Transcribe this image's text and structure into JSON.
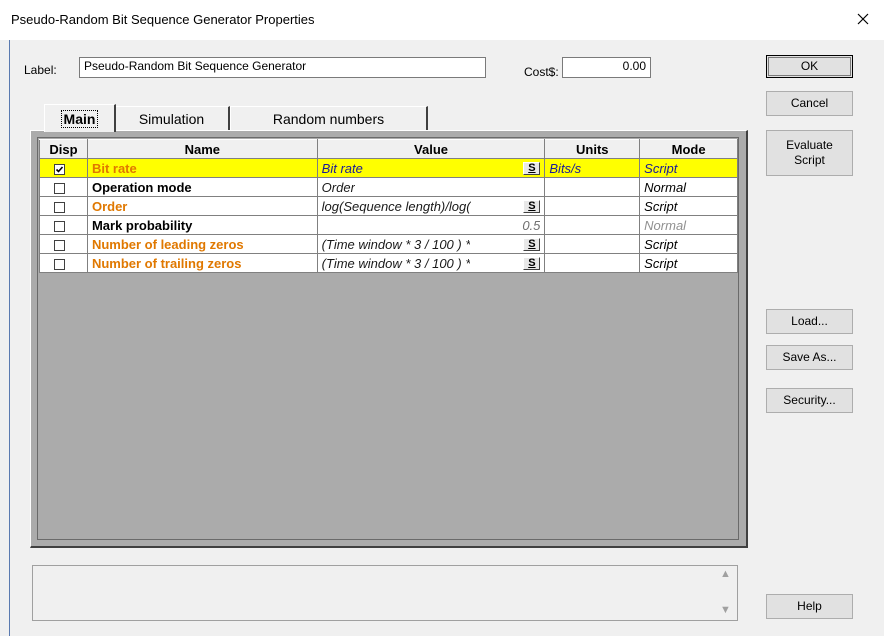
{
  "window": {
    "title": "Pseudo-Random Bit Sequence Generator Properties",
    "close_glyph": "✕"
  },
  "form": {
    "label_caption": "Label:",
    "label_value": "Pseudo-Random Bit Sequence Generator",
    "cost_caption": "Cost$:",
    "cost_value": "0.00"
  },
  "buttons": {
    "ok": "OK",
    "cancel": "Cancel",
    "evaluate_line1": "Evaluate",
    "evaluate_line2": "Script",
    "load": "Load...",
    "save_as": "Save As...",
    "security": "Security...",
    "help": "Help"
  },
  "tabs": [
    {
      "label": "Main",
      "active": true
    },
    {
      "label": "Simulation",
      "active": false
    },
    {
      "label": "Random numbers",
      "active": false
    }
  ],
  "table": {
    "headers": {
      "disp": "Disp",
      "name": "Name",
      "value": "Value",
      "units": "Units",
      "mode": "Mode"
    },
    "script_button": "S",
    "rows": [
      {
        "checked": true,
        "name": "Bit rate",
        "value": "Bit rate",
        "has_script": true,
        "units": "Bits/s",
        "mode": "Script",
        "selected": true
      },
      {
        "checked": false,
        "name": "Operation mode",
        "value": "Order",
        "has_script": false,
        "units": "",
        "mode": "Normal",
        "selected": false
      },
      {
        "checked": false,
        "name": "Order",
        "value": "log(Sequence length)/log(",
        "has_script": true,
        "units": "",
        "mode": "Script",
        "selected": false
      },
      {
        "checked": false,
        "name": "Mark probability",
        "value": "0.5",
        "has_script": false,
        "units": "",
        "mode": "Normal",
        "selected": false
      },
      {
        "checked": false,
        "name": "Number of leading zeros",
        "value": "(Time window * 3 / 100 ) *",
        "has_script": true,
        "units": "",
        "mode": "Script",
        "selected": false
      },
      {
        "checked": false,
        "name": "Number of trailing zeros",
        "value": "(Time window * 3 / 100 ) *",
        "has_script": true,
        "units": "",
        "mode": "Script",
        "selected": false
      }
    ]
  },
  "description": {
    "text": "",
    "scroll_up_glyph": "▲",
    "scroll_down_glyph": "▼"
  },
  "colors": {
    "selected_row": "#ffff00",
    "script_name": "#e07800",
    "script_value": "#1a1a9a"
  }
}
